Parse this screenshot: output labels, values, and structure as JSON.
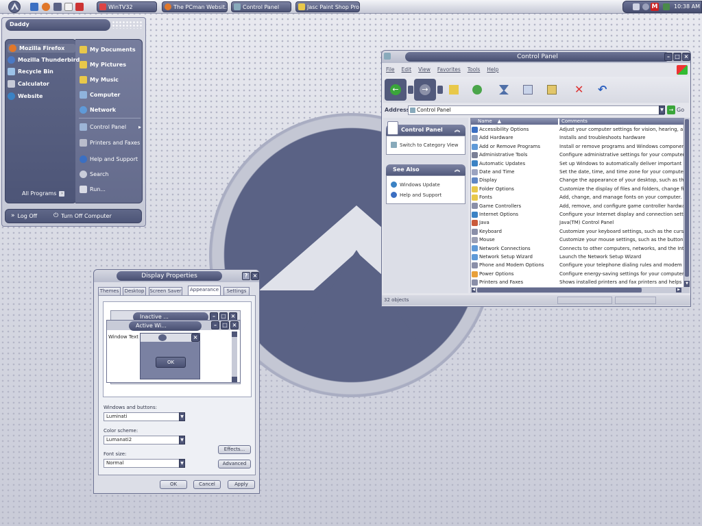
{
  "taskbar": {
    "buttons": [
      "WinTV32",
      "The PCman Websit...",
      "Control Panel",
      "Jasc Paint Shop Pro"
    ],
    "clock": "10:38 AM"
  },
  "start_menu": {
    "user": "Daddy",
    "pinned": [
      "Mozilla Firefox",
      "Mozilla Thunderbird",
      "Recycle Bin",
      "Calculator",
      "Website"
    ],
    "all_programs": "All Programs",
    "right_items": [
      "My Documents",
      "My Pictures",
      "My Music",
      "Computer",
      "Network",
      "Control Panel",
      "Printers and Faxes",
      "Help and Support",
      "Search",
      "Run..."
    ],
    "log_off": "Log Off",
    "turn_off": "Turn Off Computer"
  },
  "control_panel": {
    "title": "Control Panel",
    "menu": [
      "File",
      "Edit",
      "View",
      "Favorites",
      "Tools",
      "Help"
    ],
    "address_label": "Address",
    "address_value": "Control Panel",
    "go": "Go",
    "side_title": "Control Panel",
    "side_link": "Switch to Category View",
    "see_also": "See Also",
    "see_also_links": [
      "Windows Update",
      "Help and Support"
    ],
    "col_name": "Name",
    "col_comments": "Comments",
    "rows": [
      [
        "Accessibility Options",
        "Adjust your computer settings for vision, hearing, and mobility."
      ],
      [
        "Add Hardware",
        "Installs and troubleshoots hardware"
      ],
      [
        "Add or Remove Programs",
        "Install or remove programs and Windows components."
      ],
      [
        "Administrative Tools",
        "Configure administrative settings for your computer."
      ],
      [
        "Automatic Updates",
        "Set up Windows to automatically deliver important updates"
      ],
      [
        "Date and Time",
        "Set the date, time, and time zone for your computer."
      ],
      [
        "Display",
        "Change the appearance of your desktop, such as the background"
      ],
      [
        "Folder Options",
        "Customize the display of files and folders, change file associations"
      ],
      [
        "Fonts",
        "Add, change, and manage fonts on your computer."
      ],
      [
        "Game Controllers",
        "Add, remove, and configure game controller hardware such as"
      ],
      [
        "Internet Options",
        "Configure your Internet display and connection settings."
      ],
      [
        "Java",
        "Java(TM) Control Panel"
      ],
      [
        "Keyboard",
        "Customize your keyboard settings, such as the cursor blink rate"
      ],
      [
        "Mouse",
        "Customize your mouse settings, such as the button configuration"
      ],
      [
        "Network Connections",
        "Connects to other computers, networks, and the Internet."
      ],
      [
        "Network Setup Wizard",
        "Launch the Network Setup Wizard"
      ],
      [
        "Phone and Modem Options",
        "Configure your telephone dialing rules and modem settings."
      ],
      [
        "Power Options",
        "Configure energy-saving settings for your computer."
      ],
      [
        "Printers and Faxes",
        "Shows installed printers and fax printers and helps you add new"
      ]
    ],
    "status": "32 objects"
  },
  "display_props": {
    "title": "Display Properties",
    "tabs": [
      "Themes",
      "Desktop",
      "Screen Saver",
      "Appearance",
      "Settings"
    ],
    "inactive": "Inactive ...",
    "active": "Active Wi...",
    "window_text": "Window Text",
    "ok_preview": "OK",
    "windows_buttons_label": "Windows and buttons:",
    "windows_buttons_value": "Luminati",
    "color_scheme_label": "Color scheme:",
    "color_scheme_value": "Lumanati2",
    "font_size_label": "Font size:",
    "font_size_value": "Normal",
    "effects": "Effects...",
    "advanced": "Advanced",
    "ok": "OK",
    "cancel": "Cancel",
    "apply": "Apply"
  }
}
